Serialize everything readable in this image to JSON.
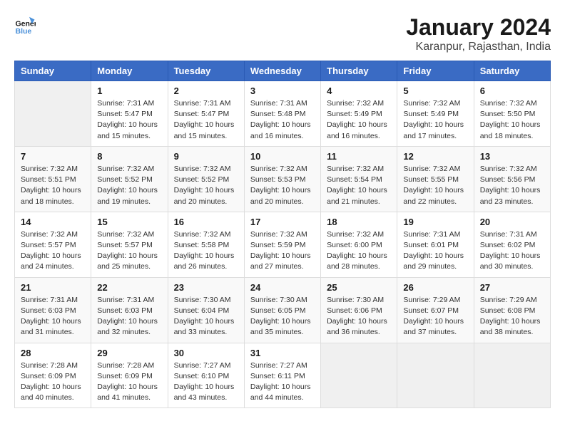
{
  "header": {
    "logo_line1": "General",
    "logo_line2": "Blue",
    "month_title": "January 2024",
    "subtitle": "Karanpur, Rajasthan, India"
  },
  "weekdays": [
    "Sunday",
    "Monday",
    "Tuesday",
    "Wednesday",
    "Thursday",
    "Friday",
    "Saturday"
  ],
  "weeks": [
    [
      {
        "day": "",
        "info": ""
      },
      {
        "day": "1",
        "info": "Sunrise: 7:31 AM\nSunset: 5:47 PM\nDaylight: 10 hours\nand 15 minutes."
      },
      {
        "day": "2",
        "info": "Sunrise: 7:31 AM\nSunset: 5:47 PM\nDaylight: 10 hours\nand 15 minutes."
      },
      {
        "day": "3",
        "info": "Sunrise: 7:31 AM\nSunset: 5:48 PM\nDaylight: 10 hours\nand 16 minutes."
      },
      {
        "day": "4",
        "info": "Sunrise: 7:32 AM\nSunset: 5:49 PM\nDaylight: 10 hours\nand 16 minutes."
      },
      {
        "day": "5",
        "info": "Sunrise: 7:32 AM\nSunset: 5:49 PM\nDaylight: 10 hours\nand 17 minutes."
      },
      {
        "day": "6",
        "info": "Sunrise: 7:32 AM\nSunset: 5:50 PM\nDaylight: 10 hours\nand 18 minutes."
      }
    ],
    [
      {
        "day": "7",
        "info": "Sunrise: 7:32 AM\nSunset: 5:51 PM\nDaylight: 10 hours\nand 18 minutes."
      },
      {
        "day": "8",
        "info": "Sunrise: 7:32 AM\nSunset: 5:52 PM\nDaylight: 10 hours\nand 19 minutes."
      },
      {
        "day": "9",
        "info": "Sunrise: 7:32 AM\nSunset: 5:52 PM\nDaylight: 10 hours\nand 20 minutes."
      },
      {
        "day": "10",
        "info": "Sunrise: 7:32 AM\nSunset: 5:53 PM\nDaylight: 10 hours\nand 20 minutes."
      },
      {
        "day": "11",
        "info": "Sunrise: 7:32 AM\nSunset: 5:54 PM\nDaylight: 10 hours\nand 21 minutes."
      },
      {
        "day": "12",
        "info": "Sunrise: 7:32 AM\nSunset: 5:55 PM\nDaylight: 10 hours\nand 22 minutes."
      },
      {
        "day": "13",
        "info": "Sunrise: 7:32 AM\nSunset: 5:56 PM\nDaylight: 10 hours\nand 23 minutes."
      }
    ],
    [
      {
        "day": "14",
        "info": "Sunrise: 7:32 AM\nSunset: 5:57 PM\nDaylight: 10 hours\nand 24 minutes."
      },
      {
        "day": "15",
        "info": "Sunrise: 7:32 AM\nSunset: 5:57 PM\nDaylight: 10 hours\nand 25 minutes."
      },
      {
        "day": "16",
        "info": "Sunrise: 7:32 AM\nSunset: 5:58 PM\nDaylight: 10 hours\nand 26 minutes."
      },
      {
        "day": "17",
        "info": "Sunrise: 7:32 AM\nSunset: 5:59 PM\nDaylight: 10 hours\nand 27 minutes."
      },
      {
        "day": "18",
        "info": "Sunrise: 7:32 AM\nSunset: 6:00 PM\nDaylight: 10 hours\nand 28 minutes."
      },
      {
        "day": "19",
        "info": "Sunrise: 7:31 AM\nSunset: 6:01 PM\nDaylight: 10 hours\nand 29 minutes."
      },
      {
        "day": "20",
        "info": "Sunrise: 7:31 AM\nSunset: 6:02 PM\nDaylight: 10 hours\nand 30 minutes."
      }
    ],
    [
      {
        "day": "21",
        "info": "Sunrise: 7:31 AM\nSunset: 6:03 PM\nDaylight: 10 hours\nand 31 minutes."
      },
      {
        "day": "22",
        "info": "Sunrise: 7:31 AM\nSunset: 6:03 PM\nDaylight: 10 hours\nand 32 minutes."
      },
      {
        "day": "23",
        "info": "Sunrise: 7:30 AM\nSunset: 6:04 PM\nDaylight: 10 hours\nand 33 minutes."
      },
      {
        "day": "24",
        "info": "Sunrise: 7:30 AM\nSunset: 6:05 PM\nDaylight: 10 hours\nand 35 minutes."
      },
      {
        "day": "25",
        "info": "Sunrise: 7:30 AM\nSunset: 6:06 PM\nDaylight: 10 hours\nand 36 minutes."
      },
      {
        "day": "26",
        "info": "Sunrise: 7:29 AM\nSunset: 6:07 PM\nDaylight: 10 hours\nand 37 minutes."
      },
      {
        "day": "27",
        "info": "Sunrise: 7:29 AM\nSunset: 6:08 PM\nDaylight: 10 hours\nand 38 minutes."
      }
    ],
    [
      {
        "day": "28",
        "info": "Sunrise: 7:28 AM\nSunset: 6:09 PM\nDaylight: 10 hours\nand 40 minutes."
      },
      {
        "day": "29",
        "info": "Sunrise: 7:28 AM\nSunset: 6:09 PM\nDaylight: 10 hours\nand 41 minutes."
      },
      {
        "day": "30",
        "info": "Sunrise: 7:27 AM\nSunset: 6:10 PM\nDaylight: 10 hours\nand 43 minutes."
      },
      {
        "day": "31",
        "info": "Sunrise: 7:27 AM\nSunset: 6:11 PM\nDaylight: 10 hours\nand 44 minutes."
      },
      {
        "day": "",
        "info": ""
      },
      {
        "day": "",
        "info": ""
      },
      {
        "day": "",
        "info": ""
      }
    ]
  ]
}
